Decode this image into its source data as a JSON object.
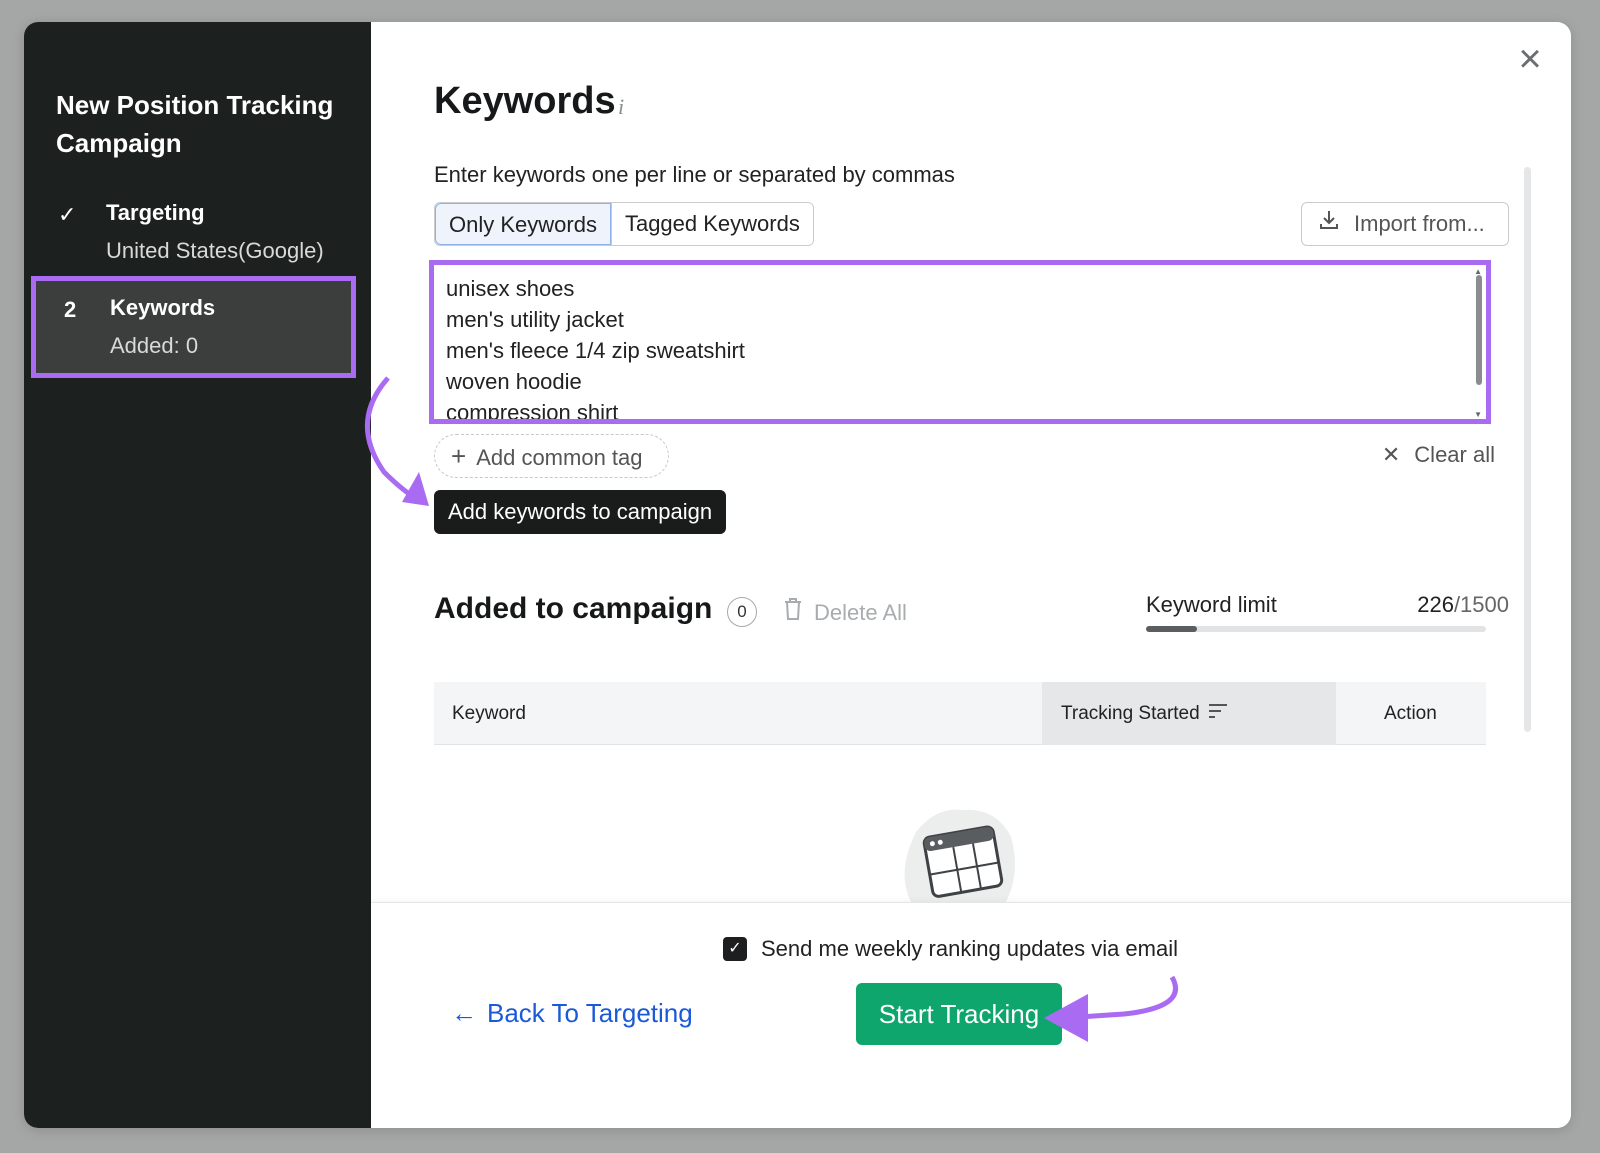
{
  "sidebar": {
    "title": "New Position Tracking Campaign",
    "steps": [
      {
        "num": "✓",
        "label": "Targeting",
        "sub": "United States(Google)"
      },
      {
        "num": "2",
        "label": "Keywords",
        "sub": "Added: 0"
      }
    ]
  },
  "main": {
    "title": "Keywords",
    "info_icon": "i",
    "instructions": "Enter keywords one per line or separated by commas",
    "tabs": [
      "Only Keywords",
      "Tagged Keywords"
    ],
    "import_label": "Import from...",
    "keywords": [
      "unisex shoes",
      "men's utility jacket",
      "men's fleece 1/4 zip sweatshirt",
      "woven hoodie",
      "compression shirt"
    ],
    "add_tag_label": "Add common tag",
    "clear_all_label": "Clear all",
    "tooltip": "Add keywords to campaign",
    "added_title": "Added to campaign",
    "added_count": "0",
    "delete_all_label": "Delete All",
    "keyword_limit_label": "Keyword limit",
    "keyword_limit_used": "226",
    "keyword_limit_total": "/1500",
    "keyword_limit_fraction": 0.1507,
    "table_headers": {
      "keyword": "Keyword",
      "tracking": "Tracking Started",
      "action": "Action"
    }
  },
  "footer": {
    "email_label": "Send me weekly ranking updates via email",
    "email_checked": true,
    "back_label": "Back To Targeting",
    "start_label": "Start Tracking"
  },
  "colors": {
    "highlight": "#a96bf2",
    "primary_green": "#0fa66e",
    "link_blue": "#1a5ad9",
    "sidebar_bg": "#1c201f"
  }
}
